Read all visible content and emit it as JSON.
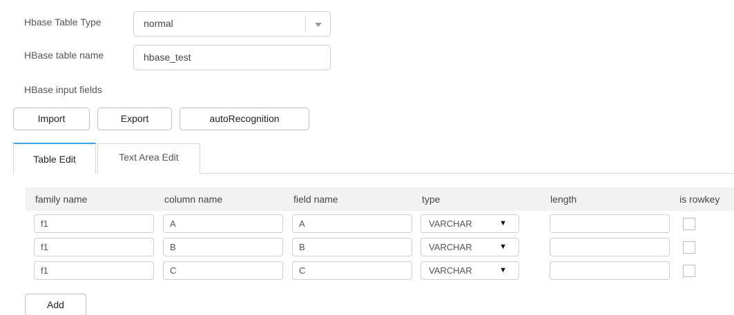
{
  "form": {
    "table_type_label": "Hbase Table Type",
    "table_type_value": "normal",
    "table_name_label": "HBase table name",
    "table_name_value": "hbase_test",
    "input_fields_label": "HBase input fields"
  },
  "toolbar": {
    "import_label": "Import",
    "export_label": "Export",
    "auto_label": "autoRecognition"
  },
  "tabs": [
    {
      "label": "Table Edit",
      "active": true
    },
    {
      "label": "Text Area Edit",
      "active": false
    }
  ],
  "table": {
    "columns": [
      "family name",
      "column name",
      "field name",
      "type",
      "length",
      "is rowkey"
    ],
    "rows": [
      {
        "family": "f1",
        "column": "A",
        "field": "A",
        "type": "VARCHAR",
        "length": "",
        "rowkey": false
      },
      {
        "family": "f1",
        "column": "B",
        "field": "B",
        "type": "VARCHAR",
        "length": "",
        "rowkey": false
      },
      {
        "family": "f1",
        "column": "C",
        "field": "C",
        "type": "VARCHAR",
        "length": "",
        "rowkey": false
      }
    ]
  },
  "add_label": "Add",
  "colors": {
    "accent_tab": "#3ba3f0",
    "header_bg": "#f2f2f2",
    "border": "#cfcfcf"
  },
  "icons": {
    "select_caret": "triangle-down",
    "type_caret": "triangle-down-solid"
  }
}
